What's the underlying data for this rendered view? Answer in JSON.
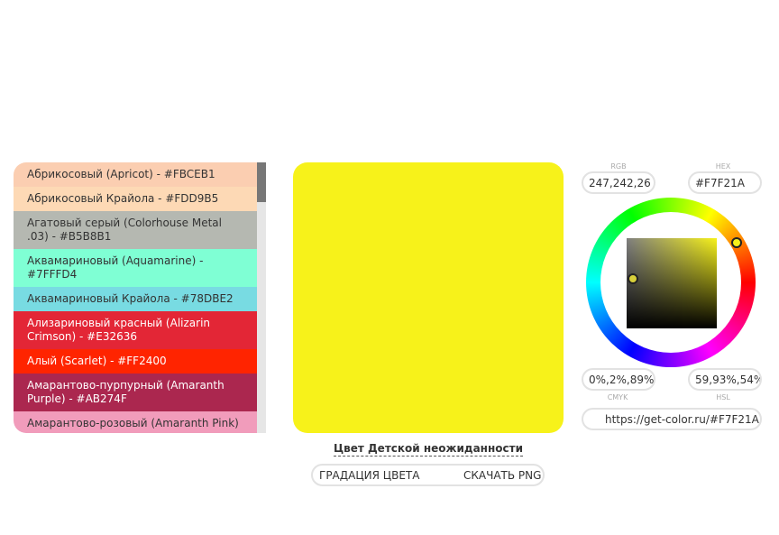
{
  "color_list": {
    "items": [
      {
        "label": "Абрикосовый (Apricot) - #FBCEB1",
        "bg": "#FBCEB1",
        "fg": "#333333"
      },
      {
        "label": "Абрикосовый Крайола - #FDD9B5",
        "bg": "#FDD9B5",
        "fg": "#333333"
      },
      {
        "label": "Агатовый серый (Colorhouse Metal .03) - #B5B8B1",
        "bg": "#B5B8B1",
        "fg": "#333333"
      },
      {
        "label": "Аквамариновый (Aquamarine) - #7FFFD4",
        "bg": "#7FFFD4",
        "fg": "#333333"
      },
      {
        "label": "Аквамариновый Крайола - #78DBE2",
        "bg": "#78DBE2",
        "fg": "#333333"
      },
      {
        "label": "Ализариновый красный (Alizarin Crimson) - #E32636",
        "bg": "#E32636",
        "fg": "#ffffff"
      },
      {
        "label": "Алый (Scarlet) - #FF2400",
        "bg": "#FF2400",
        "fg": "#ffffff"
      },
      {
        "label": "Амарантово-пурпурный (Amaranth Purple) - #AB274F",
        "bg": "#AB274F",
        "fg": "#ffffff"
      },
      {
        "label": "Амарантово-розовый (Amaranth Pink) -",
        "bg": "#F19CBB",
        "fg": "#333333"
      }
    ]
  },
  "preview": {
    "color": "#F7F21A",
    "name": "Цвет Детской неожиданности"
  },
  "actions": {
    "gradation_label": "ГРАДАЦИЯ ЦВЕТА",
    "download_label": "СКАЧАТЬ PNG"
  },
  "picker": {
    "rgb_label": "RGB",
    "rgb_value": "247,242,26",
    "hex_label": "HEX",
    "hex_value": "#F7F21A",
    "cmyk_label": "CMYK",
    "cmyk_value": "0%,2%,89%,",
    "hsl_label": "HSL",
    "hsl_value": "59,93%,54%",
    "link_value": "https://get-color.ru/#F7F21A"
  }
}
